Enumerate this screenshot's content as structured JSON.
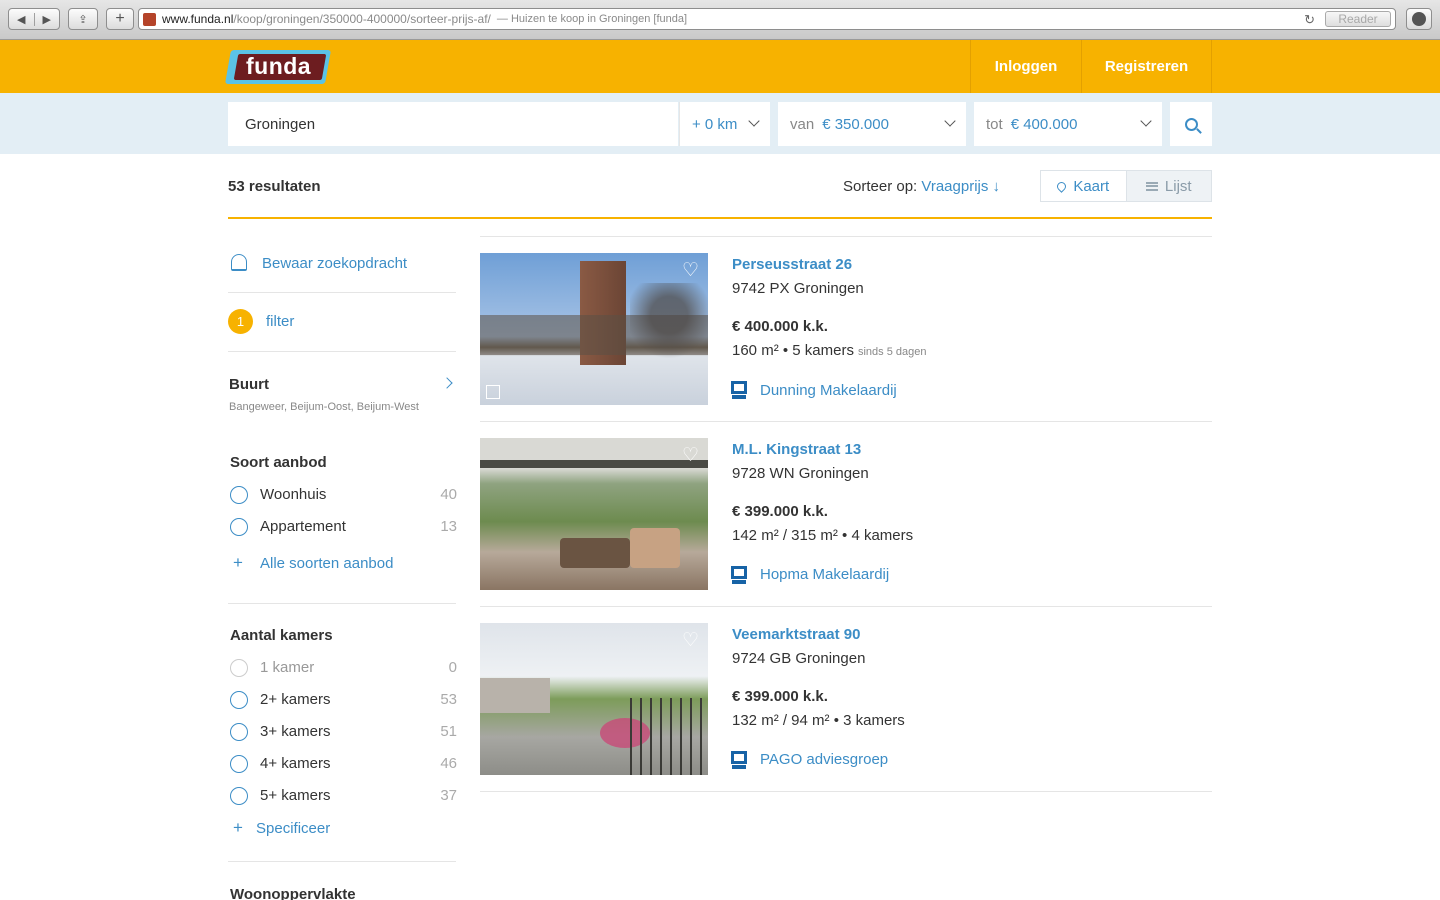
{
  "browser": {
    "url_host": "www.funda.nl",
    "url_path": "/koop/groningen/350000-400000/sorteer-prijs-af/",
    "page_title": "— Huizen te koop in Groningen [funda]",
    "reader_label": "Reader"
  },
  "header": {
    "logo_text": "funda",
    "login_label": "Inloggen",
    "register_label": "Registreren"
  },
  "search": {
    "location": "Groningen",
    "radius": "+ 0 km",
    "min_label": "van",
    "min_value": "€ 350.000",
    "max_label": "tot",
    "max_value": "€ 400.000"
  },
  "results": {
    "count_text": "53 resultaten",
    "sort_label": "Sorteer op:",
    "sort_value": "Vraagprijs ↓",
    "view_map": "Kaart",
    "view_list": "Lijst"
  },
  "sidebar": {
    "save_search": "Bewaar zoekopdracht",
    "filter_count": "1",
    "filter_label": "filter",
    "buurt_title": "Buurt",
    "buurt_values": "Bangeweer, Beijum-Oost, Beijum-West",
    "soort_title": "Soort aanbod",
    "soort_options": [
      {
        "label": "Woonhuis",
        "count": "40"
      },
      {
        "label": "Appartement",
        "count": "13"
      }
    ],
    "soort_more": "Alle soorten aanbod",
    "kamers_title": "Aantal kamers",
    "kamers_options": [
      {
        "label": "1 kamer",
        "count": "0"
      },
      {
        "label": "2+ kamers",
        "count": "53"
      },
      {
        "label": "3+ kamers",
        "count": "51"
      },
      {
        "label": "4+ kamers",
        "count": "46"
      },
      {
        "label": "5+ kamers",
        "count": "37"
      }
    ],
    "kamers_more": "Specificeer",
    "opp_title": "Woonoppervlakte"
  },
  "listings": [
    {
      "street": "Perseusstraat 26",
      "postal": "9742 PX Groningen",
      "price": "€ 400.000 k.k.",
      "specs": "160 m² • 5 kamers",
      "since": "sinds 5 dagen",
      "agent": "Dunning Makelaardij"
    },
    {
      "street": "M.L. Kingstraat 13",
      "postal": "9728 WN Groningen",
      "price": "€ 399.000 k.k.",
      "specs": "142 m² / 315 m² • 4 kamers",
      "agent": "Hopma Makelaardij"
    },
    {
      "street": "Veemarktstraat 90",
      "postal": "9724 GB Groningen",
      "price": "€ 399.000 k.k.",
      "specs": "132 m² / 94 m² • 3 kamers",
      "agent": "PAGO adviesgroep"
    }
  ],
  "icons": {
    "heart": "heart-icon",
    "bell": "bell-icon",
    "search": "search-icon",
    "map_pin": "map-pin-icon",
    "list": "list-icon",
    "nvm": "nvm-logo-icon"
  },
  "colors": {
    "brand_yellow": "#f7b200",
    "link_blue": "#3c8dc6",
    "search_bg": "#e3eef5"
  }
}
